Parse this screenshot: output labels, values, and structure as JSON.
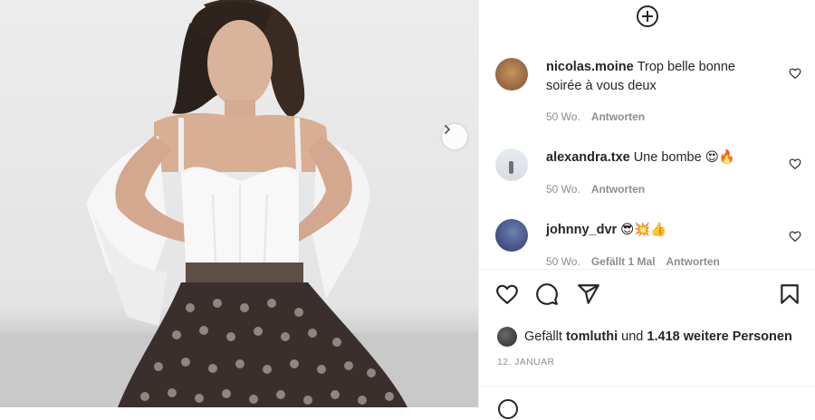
{
  "post": {
    "image_alt": "Frau in weißem Korsett-Top und gemusterter Hose",
    "date": "12. JANUAR"
  },
  "comments": [
    {
      "user": "nicolas.moine",
      "text": "Trop belle bonne soirée à vous deux",
      "age": "50 Wo.",
      "likes_text": "",
      "reply": "Antworten"
    },
    {
      "user": "alexandra.txe",
      "text": "Une bombe 😍🔥",
      "age": "50 Wo.",
      "likes_text": "",
      "reply": "Antworten"
    },
    {
      "user": "johnny_dvr",
      "text": "😎💥👍",
      "age": "50 Wo.",
      "likes_text": "Gefällt 1 Mal",
      "reply": "Antworten"
    }
  ],
  "likes": {
    "prefix": "Gefällt",
    "user": "tomluthi",
    "middle": "und",
    "count_text": "1.418 weitere Personen"
  },
  "icons": {
    "add": "plus-circle-icon",
    "next": "chevron-right-icon",
    "like": "heart-icon",
    "comment": "comment-icon",
    "share": "send-icon",
    "save": "bookmark-icon"
  },
  "colors": {
    "text": "#262626",
    "muted": "#8e8e8e",
    "divider": "#efefef"
  }
}
